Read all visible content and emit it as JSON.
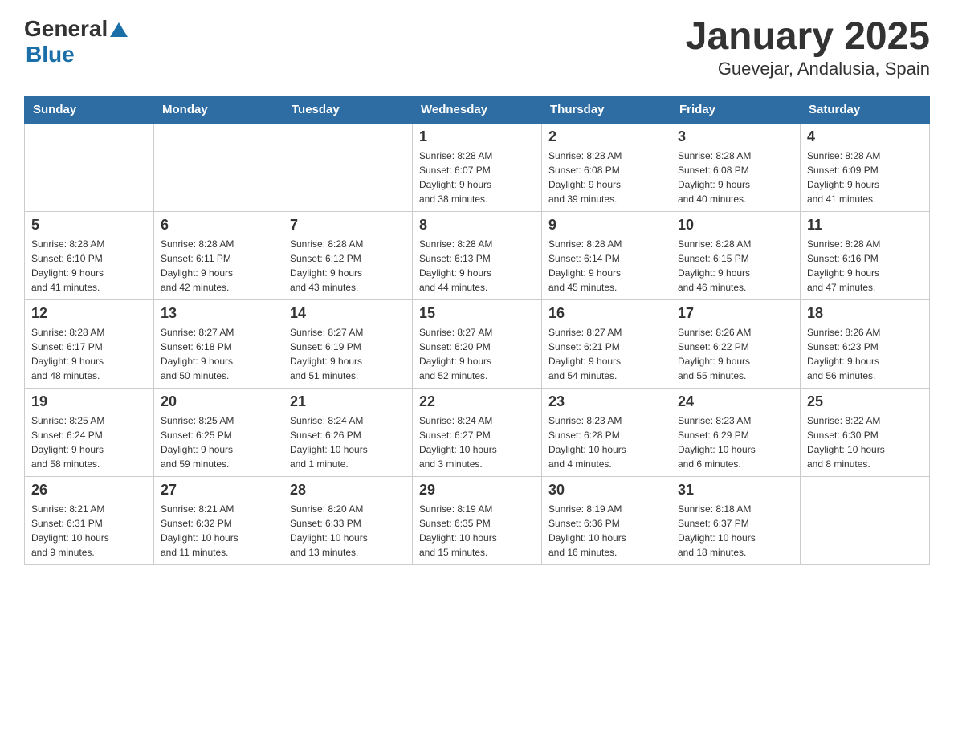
{
  "header": {
    "logo_general": "General",
    "logo_blue": "Blue",
    "title": "January 2025",
    "subtitle": "Guevejar, Andalusia, Spain"
  },
  "days": [
    "Sunday",
    "Monday",
    "Tuesday",
    "Wednesday",
    "Thursday",
    "Friday",
    "Saturday"
  ],
  "weeks": [
    [
      {
        "day": "",
        "info": ""
      },
      {
        "day": "",
        "info": ""
      },
      {
        "day": "",
        "info": ""
      },
      {
        "day": "1",
        "info": "Sunrise: 8:28 AM\nSunset: 6:07 PM\nDaylight: 9 hours\nand 38 minutes."
      },
      {
        "day": "2",
        "info": "Sunrise: 8:28 AM\nSunset: 6:08 PM\nDaylight: 9 hours\nand 39 minutes."
      },
      {
        "day": "3",
        "info": "Sunrise: 8:28 AM\nSunset: 6:08 PM\nDaylight: 9 hours\nand 40 minutes."
      },
      {
        "day": "4",
        "info": "Sunrise: 8:28 AM\nSunset: 6:09 PM\nDaylight: 9 hours\nand 41 minutes."
      }
    ],
    [
      {
        "day": "5",
        "info": "Sunrise: 8:28 AM\nSunset: 6:10 PM\nDaylight: 9 hours\nand 41 minutes."
      },
      {
        "day": "6",
        "info": "Sunrise: 8:28 AM\nSunset: 6:11 PM\nDaylight: 9 hours\nand 42 minutes."
      },
      {
        "day": "7",
        "info": "Sunrise: 8:28 AM\nSunset: 6:12 PM\nDaylight: 9 hours\nand 43 minutes."
      },
      {
        "day": "8",
        "info": "Sunrise: 8:28 AM\nSunset: 6:13 PM\nDaylight: 9 hours\nand 44 minutes."
      },
      {
        "day": "9",
        "info": "Sunrise: 8:28 AM\nSunset: 6:14 PM\nDaylight: 9 hours\nand 45 minutes."
      },
      {
        "day": "10",
        "info": "Sunrise: 8:28 AM\nSunset: 6:15 PM\nDaylight: 9 hours\nand 46 minutes."
      },
      {
        "day": "11",
        "info": "Sunrise: 8:28 AM\nSunset: 6:16 PM\nDaylight: 9 hours\nand 47 minutes."
      }
    ],
    [
      {
        "day": "12",
        "info": "Sunrise: 8:28 AM\nSunset: 6:17 PM\nDaylight: 9 hours\nand 48 minutes."
      },
      {
        "day": "13",
        "info": "Sunrise: 8:27 AM\nSunset: 6:18 PM\nDaylight: 9 hours\nand 50 minutes."
      },
      {
        "day": "14",
        "info": "Sunrise: 8:27 AM\nSunset: 6:19 PM\nDaylight: 9 hours\nand 51 minutes."
      },
      {
        "day": "15",
        "info": "Sunrise: 8:27 AM\nSunset: 6:20 PM\nDaylight: 9 hours\nand 52 minutes."
      },
      {
        "day": "16",
        "info": "Sunrise: 8:27 AM\nSunset: 6:21 PM\nDaylight: 9 hours\nand 54 minutes."
      },
      {
        "day": "17",
        "info": "Sunrise: 8:26 AM\nSunset: 6:22 PM\nDaylight: 9 hours\nand 55 minutes."
      },
      {
        "day": "18",
        "info": "Sunrise: 8:26 AM\nSunset: 6:23 PM\nDaylight: 9 hours\nand 56 minutes."
      }
    ],
    [
      {
        "day": "19",
        "info": "Sunrise: 8:25 AM\nSunset: 6:24 PM\nDaylight: 9 hours\nand 58 minutes."
      },
      {
        "day": "20",
        "info": "Sunrise: 8:25 AM\nSunset: 6:25 PM\nDaylight: 9 hours\nand 59 minutes."
      },
      {
        "day": "21",
        "info": "Sunrise: 8:24 AM\nSunset: 6:26 PM\nDaylight: 10 hours\nand 1 minute."
      },
      {
        "day": "22",
        "info": "Sunrise: 8:24 AM\nSunset: 6:27 PM\nDaylight: 10 hours\nand 3 minutes."
      },
      {
        "day": "23",
        "info": "Sunrise: 8:23 AM\nSunset: 6:28 PM\nDaylight: 10 hours\nand 4 minutes."
      },
      {
        "day": "24",
        "info": "Sunrise: 8:23 AM\nSunset: 6:29 PM\nDaylight: 10 hours\nand 6 minutes."
      },
      {
        "day": "25",
        "info": "Sunrise: 8:22 AM\nSunset: 6:30 PM\nDaylight: 10 hours\nand 8 minutes."
      }
    ],
    [
      {
        "day": "26",
        "info": "Sunrise: 8:21 AM\nSunset: 6:31 PM\nDaylight: 10 hours\nand 9 minutes."
      },
      {
        "day": "27",
        "info": "Sunrise: 8:21 AM\nSunset: 6:32 PM\nDaylight: 10 hours\nand 11 minutes."
      },
      {
        "day": "28",
        "info": "Sunrise: 8:20 AM\nSunset: 6:33 PM\nDaylight: 10 hours\nand 13 minutes."
      },
      {
        "day": "29",
        "info": "Sunrise: 8:19 AM\nSunset: 6:35 PM\nDaylight: 10 hours\nand 15 minutes."
      },
      {
        "day": "30",
        "info": "Sunrise: 8:19 AM\nSunset: 6:36 PM\nDaylight: 10 hours\nand 16 minutes."
      },
      {
        "day": "31",
        "info": "Sunrise: 8:18 AM\nSunset: 6:37 PM\nDaylight: 10 hours\nand 18 minutes."
      },
      {
        "day": "",
        "info": ""
      }
    ]
  ]
}
